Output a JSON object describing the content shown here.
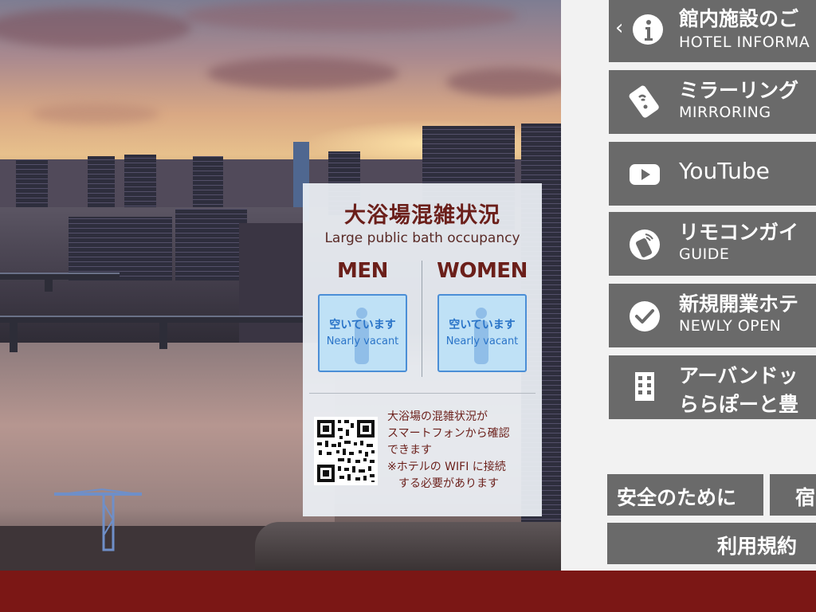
{
  "occupancy": {
    "title_jp": "大浴場混雑状況",
    "title_en": "Large public bath occupancy",
    "men": {
      "label": "MEN",
      "status_jp": "空いています",
      "status_en": "Nearly vacant"
    },
    "women": {
      "label": "WOMEN",
      "status_jp": "空いています",
      "status_en": "Nearly vacant"
    },
    "qr_note_lines": [
      "大浴場の混雑状況が",
      "スマートフォンから確認",
      "できます",
      "※ホテルの WIFI に接続",
      "する必要があります"
    ]
  },
  "menu": {
    "hotel_info": {
      "jp": "館内施設のご",
      "en": "HOTEL INFORMA",
      "icon": "info-icon"
    },
    "mirroring": {
      "jp": "ミラーリング",
      "en": "MIRRORING",
      "icon": "phone-cast-icon"
    },
    "youtube": {
      "label": "YouTube",
      "icon": "youtube-icon"
    },
    "remote_guide": {
      "jp": "リモコンガイ",
      "en": "GUIDE",
      "icon": "remote-icon"
    },
    "newly_open": {
      "jp": "新規開業ホテ",
      "en": "NEWLY OPEN",
      "icon": "check-icon"
    },
    "urban_dock": {
      "line1": "アーバンドッ",
      "line2": "ららぽーと豊",
      "icon": "building-icon"
    },
    "safety": {
      "label": "安全のために"
    },
    "stay": {
      "label": "宿"
    },
    "terms": {
      "label": "利用規約"
    }
  },
  "colors": {
    "accent": "#7b1715",
    "menu_button": "#6a6a6a",
    "status_box": "#bfe1f6",
    "status_text": "#2a74c8"
  }
}
